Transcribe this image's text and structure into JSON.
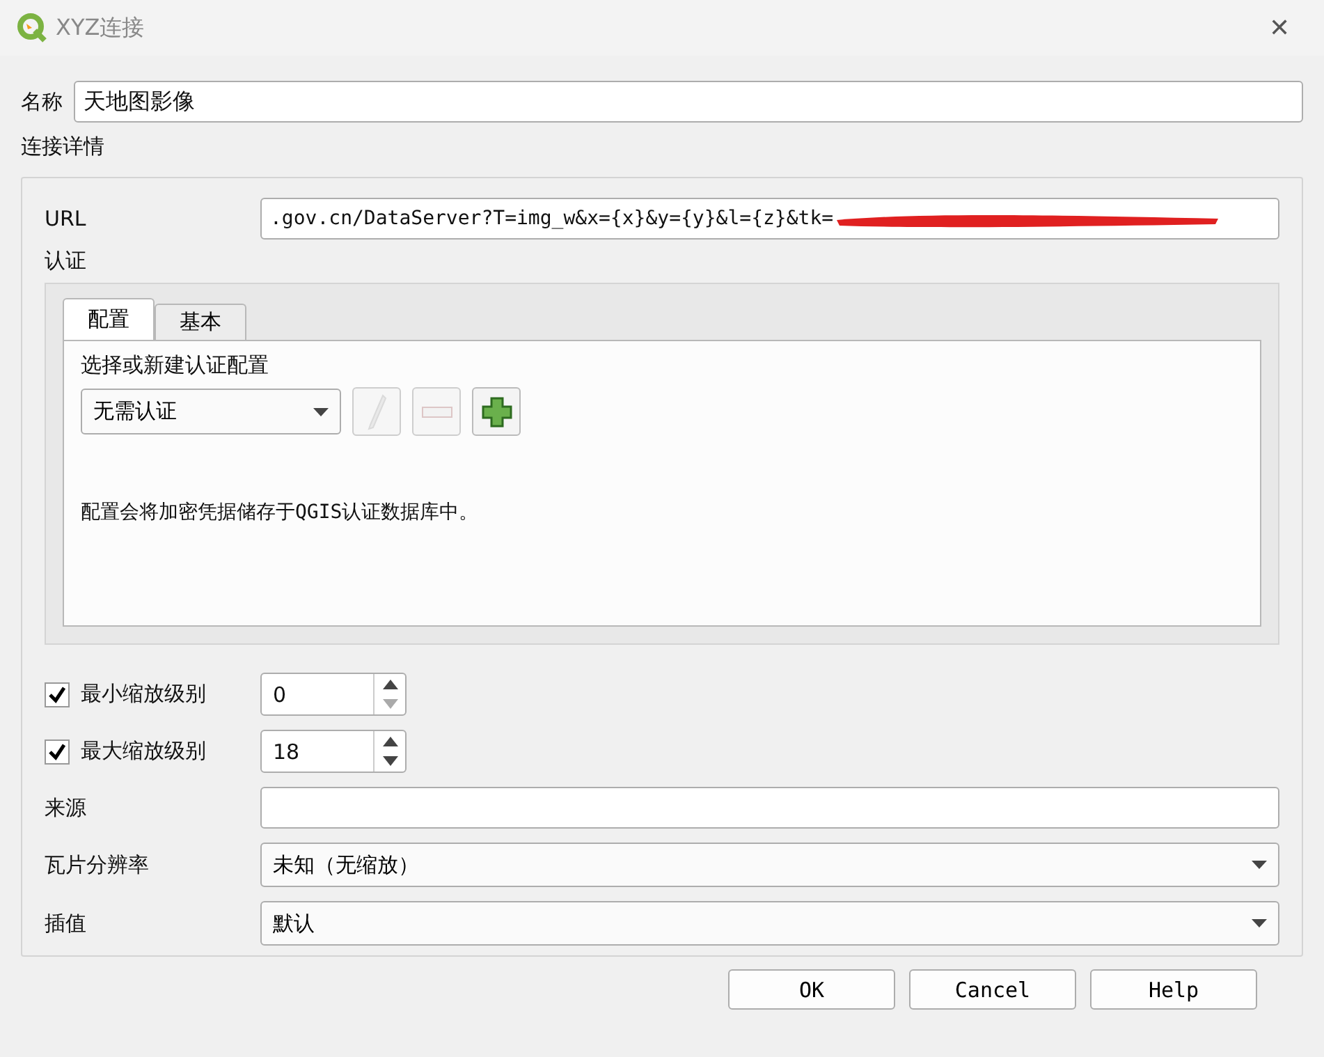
{
  "window": {
    "title": "XYZ连接",
    "close": "✕"
  },
  "name": {
    "label": "名称",
    "value": "天地图影像"
  },
  "details": {
    "title": "连接详情",
    "url": {
      "label": "URL",
      "value": ".gov.cn/DataServer?T=img_w&x={x}&y={y}&l={z}&tk=",
      "redacted": true
    },
    "auth": {
      "title": "认证",
      "tabs": [
        {
          "label": "配置",
          "selected": true
        },
        {
          "label": "基本",
          "selected": false
        }
      ],
      "prompt": "选择或新建认证配置",
      "config": "无需认证",
      "tools": [
        {
          "kind": "edit",
          "disabled": true
        },
        {
          "kind": "remove",
          "disabled": true
        },
        {
          "kind": "add",
          "disabled": false
        }
      ],
      "note": "配置会将加密凭据储存于QGIS认证数据库中。"
    },
    "zooms": [
      {
        "label": "最小缩放级别",
        "checked": true,
        "value": "0",
        "down_disabled": true
      },
      {
        "label": "最大缩放级别",
        "checked": true,
        "value": "18",
        "down_disabled": false
      }
    ],
    "fields": [
      {
        "kind": "text",
        "label": "来源"
      },
      {
        "kind": "select",
        "label": "瓦片分辨率",
        "value": "未知（无缩放）"
      },
      {
        "kind": "select",
        "label": "插值",
        "value": "默认"
      }
    ]
  },
  "buttons": [
    "OK",
    "Cancel",
    "Help"
  ]
}
